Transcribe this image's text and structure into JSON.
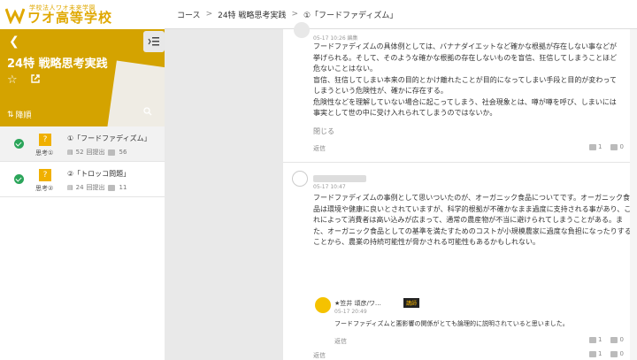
{
  "logo": {
    "sub": "学校法人ワオ未来学園",
    "main": "ワオ高等学校"
  },
  "breadcrumb": {
    "course": "コース",
    "lesson": "24特 戦略思考実践",
    "topic": "①「フードファディズム」"
  },
  "course_header": {
    "title": "24特 戦略思考実践",
    "sort_label": "降順"
  },
  "lessons": [
    {
      "q": "?",
      "label": "思考①",
      "title": "①「フードファディズム」",
      "comments": "52",
      "submitted": "回提出",
      "likes": "56"
    },
    {
      "q": "?",
      "label": "思考②",
      "title": "②「トロッコ問題」",
      "comments": "24",
      "submitted": "回提出",
      "likes": "11"
    }
  ],
  "comment1": {
    "meta": "05-17 10:26 編集",
    "text": "フードファディズムの具体例としては、バナナダイエットなど確かな根拠が存在しない事などが挙げられる。そして、そのような確かな根拠の存在しないものを盲信、狂信してしまうことほど危ないことはない。\n盲信、狂信してしまい本来の目的とかけ離れたことが目的になってしまい手段と目的が変わってしまうという危険性が、確かに存在する。\n危険性などを理解していない場合に起こってしまう、社会現象とは、噂が噂を呼び、しまいには事実として世の中に受け入れられてしまうのではないか。",
    "close": "閉じる",
    "reply": "返信",
    "like": "1",
    "dislike": "0"
  },
  "comment2": {
    "meta": "05-17 10:47",
    "text": "フードファディズムの事例として思いついたのが、オーガニック食品についてです。オーガニック食品は環境や健康に良いとされていますが、科学的根拠が不確かなまま過度に支持される事があり、これによって消費者は高い込みが広まって、通常の農産物が不当に避けられてしまうことがある。また、オーガニック食品としての基準を満たすためのコストが小規模農家に過度な負担になったりすることから、農業の持続可能性が脅かされる可能性もあるかもしれない。",
    "reply": "返信",
    "like": "1",
    "dislike": "0"
  },
  "reply1": {
    "name": "★笠井 頌彦/ワ…",
    "tag": "講師",
    "meta": "05-17 20:49",
    "text": "フードファディズムと悪影響の関係がとても論理的に説明されていると思いました。",
    "reply": "返信",
    "like": "1",
    "dislike": "0"
  },
  "colors": {
    "brand": "#d4a300",
    "check": "#2ba55a"
  }
}
